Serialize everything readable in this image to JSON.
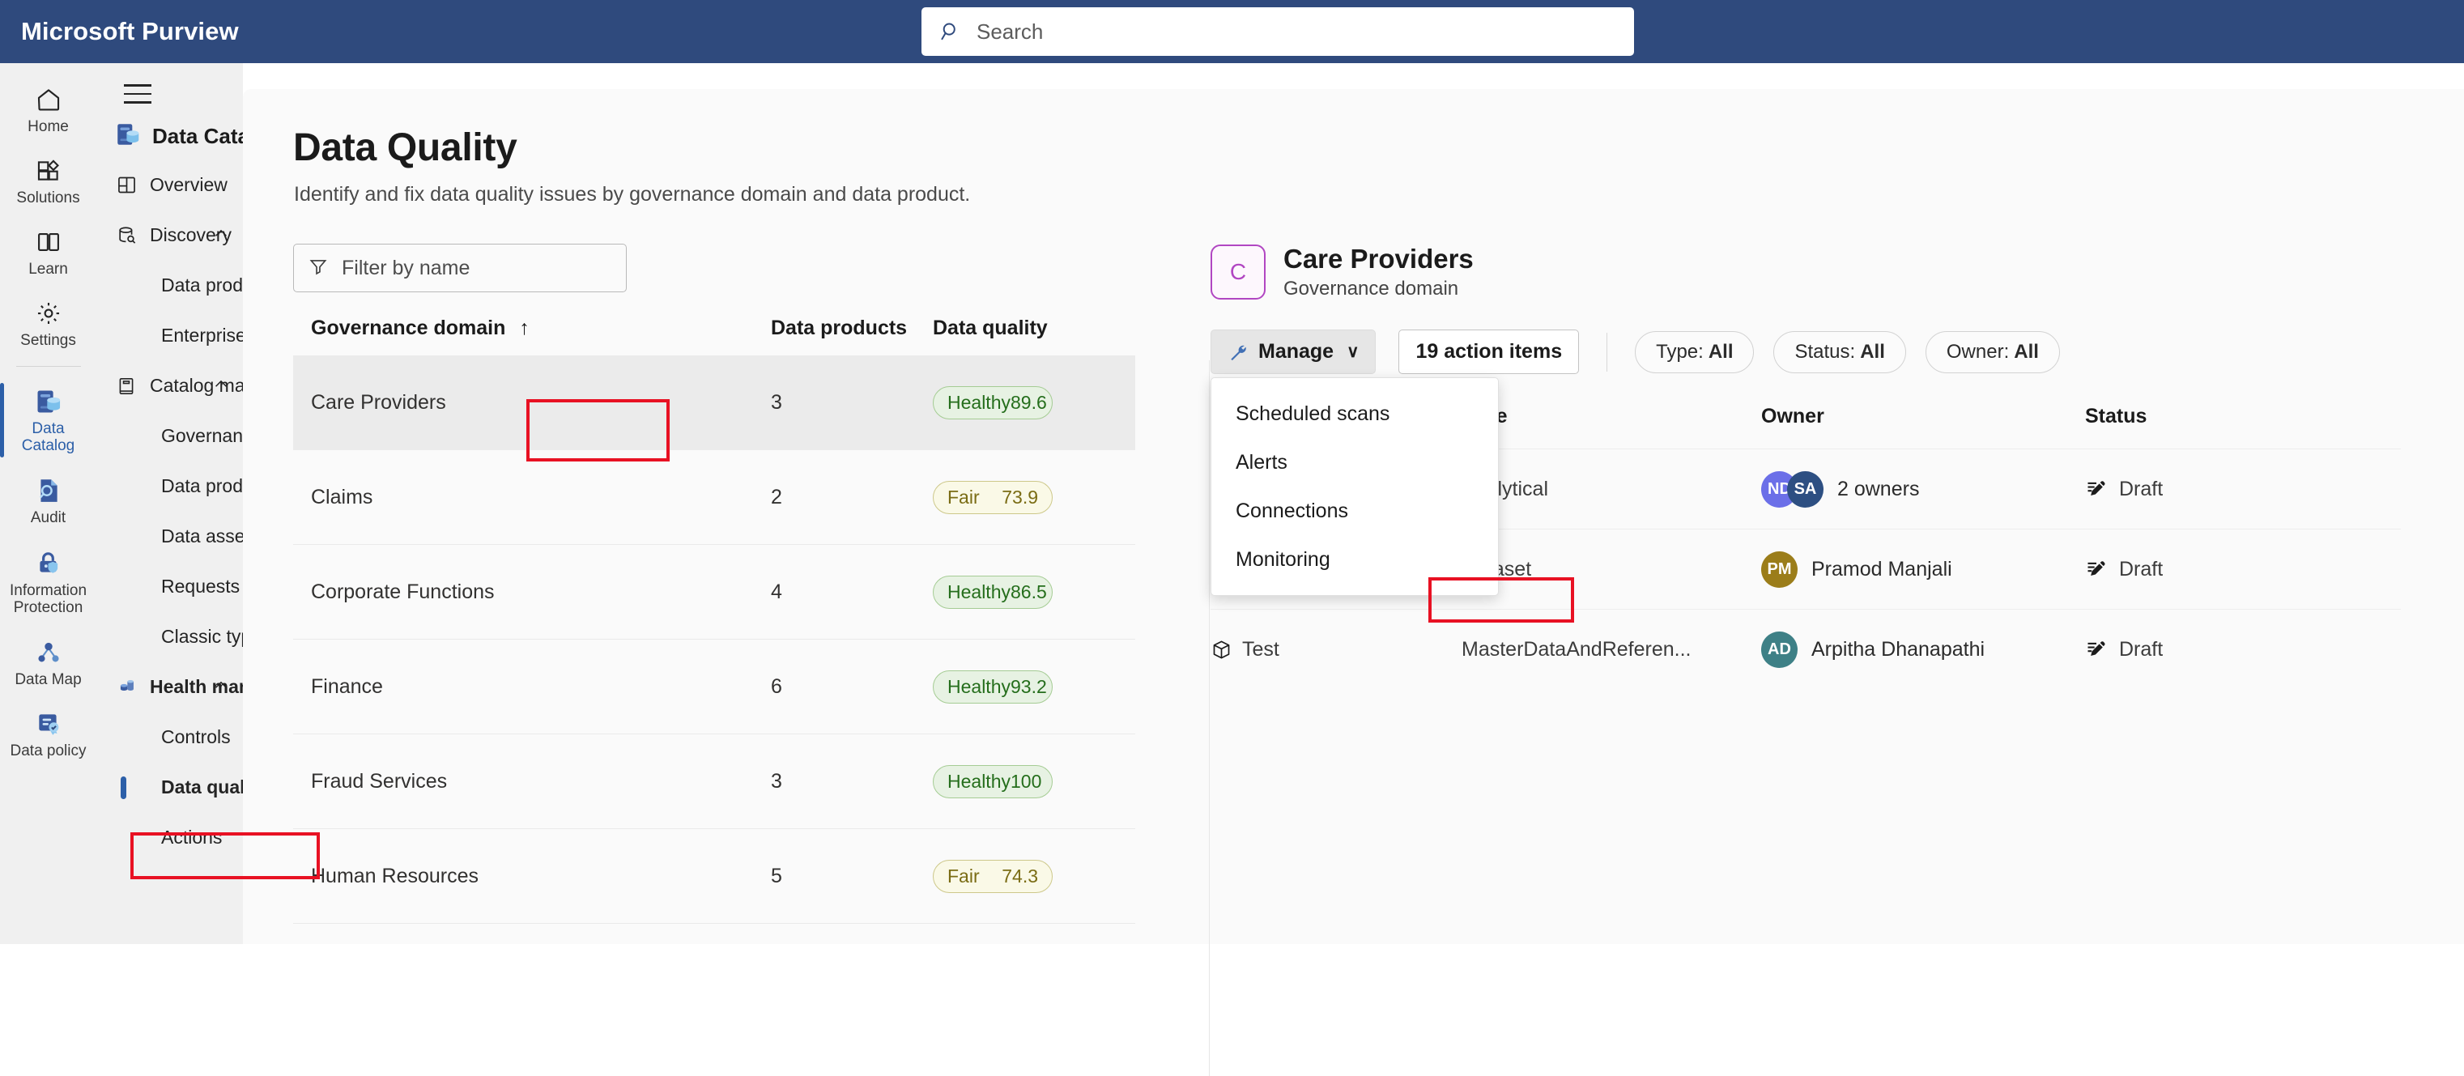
{
  "topbar": {
    "brand": "Microsoft Purview",
    "search_placeholder": "Search",
    "search_value": "",
    "search_icon": "search-icon",
    "background": "#2f4a7d"
  },
  "rail": {
    "items": [
      {
        "label": "Home",
        "icon": "home-icon",
        "selected": false
      },
      {
        "label": "Solutions",
        "icon": "solutions-icon",
        "selected": false
      },
      {
        "label": "Learn",
        "icon": "book-open-icon",
        "selected": false
      },
      {
        "label": "Settings",
        "icon": "gear-icon",
        "selected": false
      },
      {
        "label": "Data\nCatalog",
        "icon": "data-catalog-icon",
        "selected": true
      },
      {
        "label": "Audit",
        "icon": "audit-icon",
        "selected": false
      },
      {
        "label": "Information\nProtection",
        "icon": "shield-lock-icon",
        "selected": false
      },
      {
        "label": "Data Map",
        "icon": "data-map-icon",
        "selected": false
      },
      {
        "label": "Data policy",
        "icon": "data-policy-icon",
        "selected": false
      }
    ]
  },
  "sidenav": {
    "hamburger_icon": "hamburger-icon",
    "section_title": "Data Catalog",
    "section_icon": "data-catalog-icon",
    "items": [
      {
        "label": "Overview",
        "icon": "overview-icon",
        "level": 0,
        "chevron": ""
      },
      {
        "label": "Discovery",
        "icon": "discovery-icon",
        "level": 0,
        "chevron": "up"
      },
      {
        "label": "Data products",
        "icon": "",
        "level": 1,
        "chevron": ""
      },
      {
        "label": "Enterprise glossary",
        "icon": "",
        "level": 1,
        "chevron": ""
      },
      {
        "label": "Catalog management",
        "icon": "catalog-icon",
        "level": 0,
        "chevron": "up"
      },
      {
        "label": "Governance domains",
        "icon": "",
        "level": 1,
        "chevron": ""
      },
      {
        "label": "Data products",
        "icon": "",
        "level": 1,
        "chevron": ""
      },
      {
        "label": "Data assets",
        "icon": "",
        "level": 1,
        "chevron": ""
      },
      {
        "label": "Requests",
        "icon": "",
        "level": 1,
        "chevron": ""
      },
      {
        "label": "Classic types",
        "icon": "",
        "level": 1,
        "chevron": ""
      },
      {
        "label": "Health management",
        "icon": "health-icon",
        "level": 0,
        "chevron": "up",
        "bold": true
      },
      {
        "label": "Controls",
        "icon": "",
        "level": 1,
        "chevron": ""
      },
      {
        "label": "Data quality",
        "icon": "",
        "level": 1,
        "chevron": "",
        "active": true,
        "highlighted": true
      },
      {
        "label": "Actions",
        "icon": "",
        "level": 1,
        "chevron": ""
      }
    ]
  },
  "page": {
    "title": "Data Quality",
    "subtitle": "Identify and fix data quality issues by governance domain and data product."
  },
  "filter": {
    "placeholder": "Filter by name",
    "value": "",
    "icon": "funnel-icon"
  },
  "domains_table": {
    "columns": [
      "Governance domain",
      "Data products",
      "Data quality"
    ],
    "sort_indicator": "↑",
    "rows": [
      {
        "domain": "Care Providers",
        "products": "3",
        "quality_label": "Healthy",
        "quality_score": "89.6",
        "quality_state": "healthy",
        "selected": true,
        "highlighted": true
      },
      {
        "domain": "Claims",
        "products": "2",
        "quality_label": "Fair",
        "quality_score": "73.9",
        "quality_state": "fair",
        "selected": false
      },
      {
        "domain": "Corporate Functions",
        "products": "4",
        "quality_label": "Healthy",
        "quality_score": "86.5",
        "quality_state": "healthy",
        "selected": false
      },
      {
        "domain": "Finance",
        "products": "6",
        "quality_label": "Healthy",
        "quality_score": "93.2",
        "quality_state": "healthy",
        "selected": false
      },
      {
        "domain": "Fraud Services",
        "products": "3",
        "quality_label": "Healthy",
        "quality_score": "100",
        "quality_state": "healthy",
        "selected": false
      },
      {
        "domain": "Human Resources",
        "products": "5",
        "quality_label": "Fair",
        "quality_score": "74.3",
        "quality_state": "fair",
        "selected": false
      }
    ]
  },
  "detail": {
    "avatar_initial": "C",
    "avatar_color": "#b146c2",
    "title": "Care Providers",
    "subtitle": "Governance domain",
    "manage_button": "Manage",
    "manage_icon": "wrench-icon",
    "manage_chevron": "∨",
    "action_items_button": "19 action items",
    "chips": [
      {
        "prefix": "Type:",
        "value": "All"
      },
      {
        "prefix": "Status:",
        "value": "All"
      },
      {
        "prefix": "Owner:",
        "value": "All"
      }
    ],
    "menu": {
      "items": [
        {
          "label": "Scheduled scans",
          "highlighted": false
        },
        {
          "label": "Alerts",
          "highlighted": false
        },
        {
          "label": "Connections",
          "highlighted": true
        },
        {
          "label": "Monitoring",
          "highlighted": false
        }
      ]
    },
    "products_table": {
      "columns": [
        "",
        "Type",
        "Owner",
        "Status"
      ],
      "rows": [
        {
          "name": "",
          "name_icon": "",
          "type": "Analytical",
          "owners": [
            {
              "initials": "ND",
              "color": "#6b6fe8"
            },
            {
              "initials": "SA",
              "color": "#2d4f82"
            }
          ],
          "owner_label": "2 owners",
          "status": "Draft",
          "status_icon": "draft-pencil-icon"
        },
        {
          "name": "",
          "name_icon": "",
          "type": "Dataset",
          "owners": [
            {
              "initials": "PM",
              "color": "#9b7d1a"
            }
          ],
          "owner_label": "Pramod Manjali",
          "status": "Draft",
          "status_icon": "draft-pencil-icon"
        },
        {
          "name": "Test",
          "name_icon": "package-icon",
          "type": "MasterDataAndReferen...",
          "owners": [
            {
              "initials": "AD",
              "color": "#3e8086"
            }
          ],
          "owner_label": "Arpitha Dhanapathi",
          "status": "Draft",
          "status_icon": "draft-pencil-icon"
        }
      ]
    }
  },
  "colors": {
    "accent": "#2c5fa8",
    "header_bg": "#2f4a7d",
    "highlight_box": "#e81123",
    "healthy_text": "#256e1c",
    "healthy_bg": "#e7f2e3",
    "fair_text": "#7a6c14",
    "fair_bg": "#faf9e7"
  }
}
